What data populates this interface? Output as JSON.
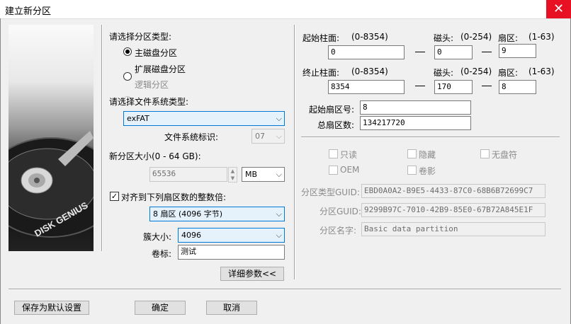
{
  "window": {
    "title": "建立新分区",
    "close_icon": "✕"
  },
  "left": {
    "partition_type_label": "请选择分区类型:",
    "radios": [
      {
        "label": "主磁盘分区",
        "checked": true,
        "enabled": true
      },
      {
        "label": "扩展磁盘分区",
        "checked": false,
        "enabled": true
      },
      {
        "label": "逻辑分区",
        "checked": false,
        "enabled": false
      }
    ],
    "fs_type_label": "请选择文件系统类型:",
    "fs_type_value": "exFAT",
    "fs_id_label": "文件系统标识:",
    "fs_id_value": "07",
    "size_label": "新分区大小(0 - 64 GB):",
    "size_value": "65536",
    "size_unit": "MB",
    "align_label": "对齐到下列扇区数的整数倍:",
    "align_value": "8 扇区 (4096 字节)",
    "cluster_label": "簇大小:",
    "cluster_value": "4096",
    "volume_label_label": "卷标:",
    "volume_label_value": "测试",
    "details_button": "详细参数<<"
  },
  "right": {
    "start_cyl_label": "起始柱面:",
    "start_cyl_range": "(0-8354)",
    "start_cyl_value": "0",
    "head_label": "磁头:",
    "head_range": "(0-254)",
    "start_head_value": "0",
    "sector_label": "扇区:",
    "sector_range": "(1-63)",
    "start_sector_value": "9",
    "end_cyl_label": "终止柱面:",
    "end_cyl_range": "(0-8354)",
    "end_cyl_value": "8354",
    "end_head_value": "170",
    "end_sector_value": "8",
    "start_sector_no_label": "起始扇区号:",
    "start_sector_no_value": "8",
    "total_sectors_label": "总扇区数:",
    "total_sectors_value": "134217720",
    "flags": [
      "只读",
      "隐藏",
      "无盘符",
      "OEM",
      "卷影"
    ],
    "type_guid_label": "分区类型GUID:",
    "type_guid_value": "EBD0A0A2-B9E5-4433-87C0-68B6B72699C7",
    "guid_label": "分区GUID:",
    "guid_value": "9299B97C-7010-42B9-85E0-67B72A845E1F",
    "name_label": "分区名字:",
    "name_value": "Basic data partition"
  },
  "footer": {
    "save_default": "保存为默认设置",
    "ok": "确定",
    "cancel": "取消"
  },
  "art": {
    "brand": "DISK GENIUS"
  }
}
